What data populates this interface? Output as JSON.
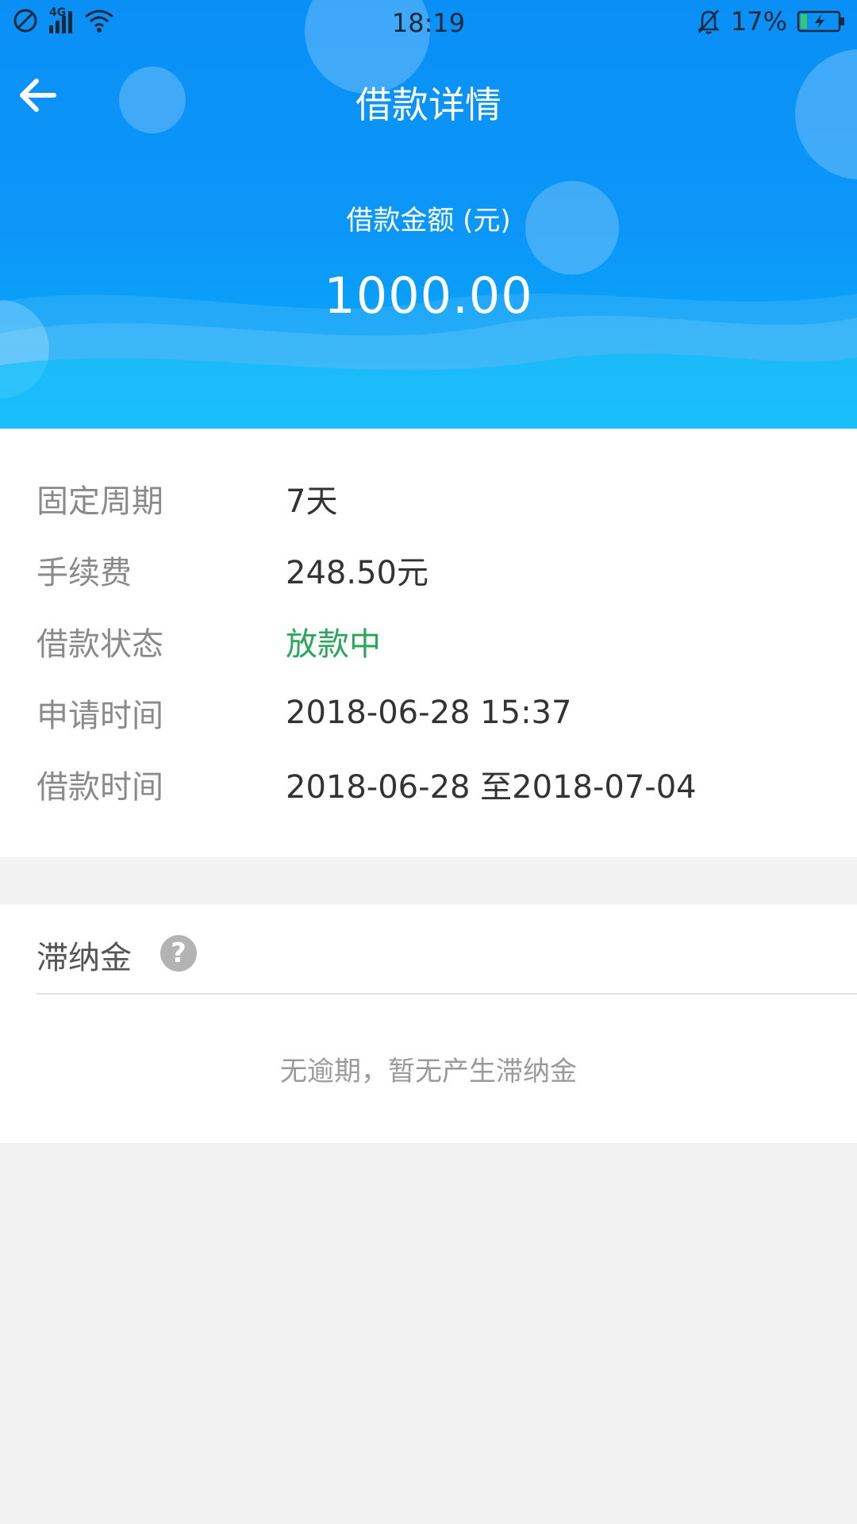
{
  "status_bar": {
    "network": "4G",
    "time": "18:19",
    "battery_percent": "17%",
    "battery_level": 0.17
  },
  "nav": {
    "title": "借款详情"
  },
  "amount": {
    "label": "借款金额 (元)",
    "value": "1000.00"
  },
  "details": [
    {
      "label": "固定周期",
      "value": "7天"
    },
    {
      "label": "手续费",
      "value": "248.50元"
    },
    {
      "label": "借款状态",
      "value": "放款中"
    },
    {
      "label": "申请时间",
      "value": "2018-06-28 15:37"
    },
    {
      "label": "借款时间",
      "value": "2018-06-28 至2018-07-04"
    }
  ],
  "late_fee": {
    "title": "滞纳金",
    "help_glyph": "?",
    "empty_text": "无逾期，暂无产生滞纳金"
  },
  "colors": {
    "header_blue": "#0c97f8",
    "status_green": "#2aa55a",
    "label_gray": "#8a8a8a",
    "background": "#f2f2f2"
  }
}
